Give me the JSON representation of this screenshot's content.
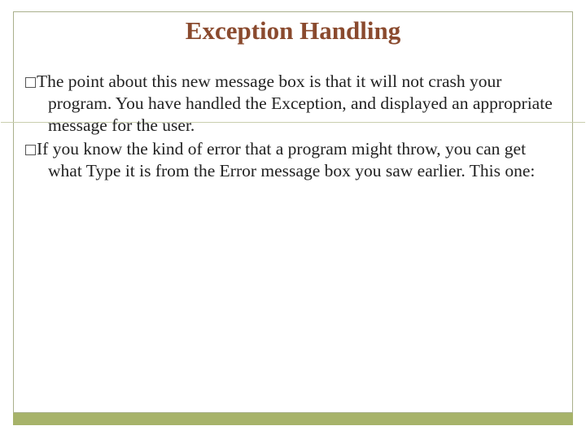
{
  "title": "Exception Handling",
  "bullets": [
    "The point about this new message box is that it will not crash your program. You have handled the Exception, and displayed an appropriate message for the user.",
    "If you know the kind of error that a program might throw, you can get what Type it is from the Error message box you saw earlier. This one:"
  ]
}
